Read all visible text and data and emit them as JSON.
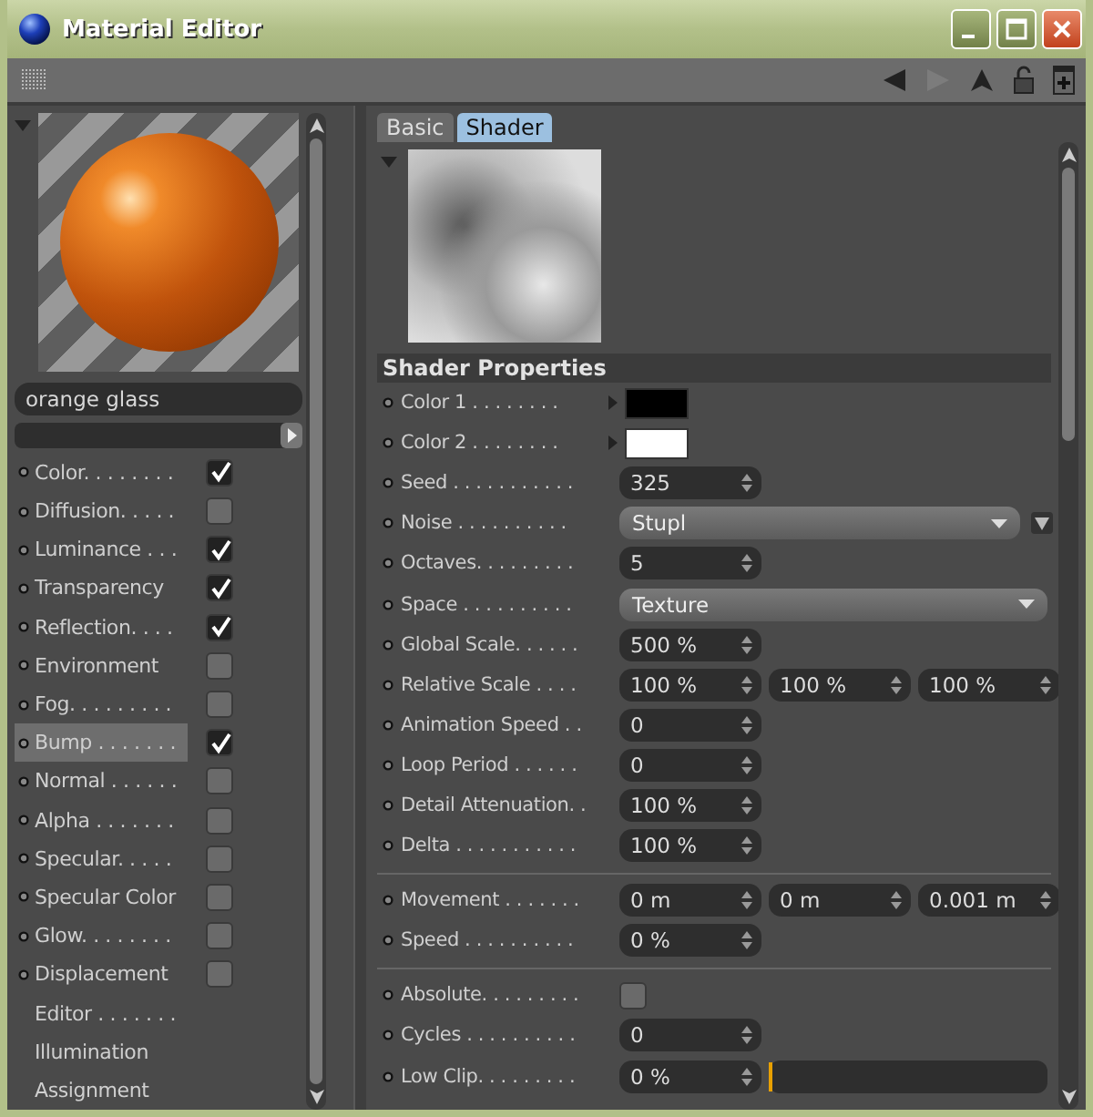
{
  "window": {
    "title": "Material Editor"
  },
  "material": {
    "name": "orange glass"
  },
  "channels": [
    {
      "label": "Color. . . . . . . .",
      "kind": "channel",
      "checked": true,
      "selected": false
    },
    {
      "label": "Diffusion. . . . .",
      "kind": "channel",
      "checked": false,
      "selected": false
    },
    {
      "label": "Luminance . . .",
      "kind": "channel",
      "checked": true,
      "selected": false
    },
    {
      "label": "Transparency",
      "kind": "channel",
      "checked": true,
      "selected": false
    },
    {
      "label": "Reflection. . . .",
      "kind": "channel",
      "checked": true,
      "selected": false
    },
    {
      "label": "Environment",
      "kind": "channel",
      "checked": false,
      "selected": false
    },
    {
      "label": "Fog. . . . . . . . .",
      "kind": "channel",
      "checked": false,
      "selected": false
    },
    {
      "label": "Bump . . . . . . .",
      "kind": "channel",
      "checked": true,
      "selected": true
    },
    {
      "label": "Normal . . . . . .",
      "kind": "channel",
      "checked": false,
      "selected": false
    },
    {
      "label": "Alpha . . . . . . .",
      "kind": "channel",
      "checked": false,
      "selected": false
    },
    {
      "label": "Specular. . . . .",
      "kind": "channel",
      "checked": false,
      "selected": false
    },
    {
      "label": "Specular Color",
      "kind": "channel",
      "checked": false,
      "selected": false
    },
    {
      "label": "Glow. . . . . . . .",
      "kind": "channel",
      "checked": false,
      "selected": false
    },
    {
      "label": "Displacement",
      "kind": "channel",
      "checked": false,
      "selected": false
    },
    {
      "label": "Editor . . . . . . .",
      "kind": "page",
      "selected": false
    },
    {
      "label": "Illumination",
      "kind": "page",
      "selected": false
    },
    {
      "label": "Assignment",
      "kind": "page",
      "selected": false
    }
  ],
  "tabs": [
    {
      "label": "Basic",
      "selected": false
    },
    {
      "label": "Shader",
      "selected": true
    }
  ],
  "section": {
    "title": "Shader Properties"
  },
  "groups": [
    {
      "rows": [
        {
          "label": "Color 1 . . . . . . . .",
          "kind": "color",
          "color": "#000000"
        },
        {
          "label": "Color 2 . . . . . . . .",
          "kind": "color",
          "color": "#ffffff"
        },
        {
          "label": "Seed . . . . . . . . . . .",
          "kind": "number",
          "values": [
            "325"
          ]
        },
        {
          "label": "Noise . . . . . . . . . .",
          "kind": "dropdown-menu",
          "value": "Stupl"
        },
        {
          "label": "Octaves. . . . . . . . .",
          "kind": "number",
          "values": [
            "5"
          ]
        },
        {
          "label": "Space . . . . . . . . . .",
          "kind": "dropdown",
          "value": "Texture"
        },
        {
          "label": "Global Scale. . . . . .",
          "kind": "number",
          "values": [
            "500 %"
          ]
        },
        {
          "label": "Relative Scale . . . .",
          "kind": "number",
          "values": [
            "100 %",
            "100 %",
            "100 %"
          ]
        },
        {
          "label": "Animation Speed . .",
          "kind": "number",
          "values": [
            "0"
          ]
        },
        {
          "label": "Loop Period . . . . . .",
          "kind": "number",
          "values": [
            "0"
          ]
        },
        {
          "label": "Detail Attenuation. .",
          "kind": "number",
          "values": [
            "100 %"
          ]
        },
        {
          "label": "Delta . . . . . . . . . . .",
          "kind": "number",
          "values": [
            "100 %"
          ]
        }
      ]
    },
    {
      "rows": [
        {
          "label": "Movement . . . . . . .",
          "kind": "number",
          "values": [
            "0 m",
            "0 m",
            "0.001 m"
          ]
        },
        {
          "label": "Speed . . . . . . . . . .",
          "kind": "number",
          "values": [
            "0 %"
          ]
        }
      ]
    },
    {
      "rows": [
        {
          "label": "Absolute. . . . . . . . .",
          "kind": "checkbox",
          "checked": false
        },
        {
          "label": "Cycles . . . . . . . . . .",
          "kind": "number",
          "values": [
            "0"
          ]
        },
        {
          "label": "Low Clip. . . . . . . . .",
          "kind": "slider",
          "values": [
            "0 %"
          ],
          "level": 0
        }
      ]
    }
  ]
}
